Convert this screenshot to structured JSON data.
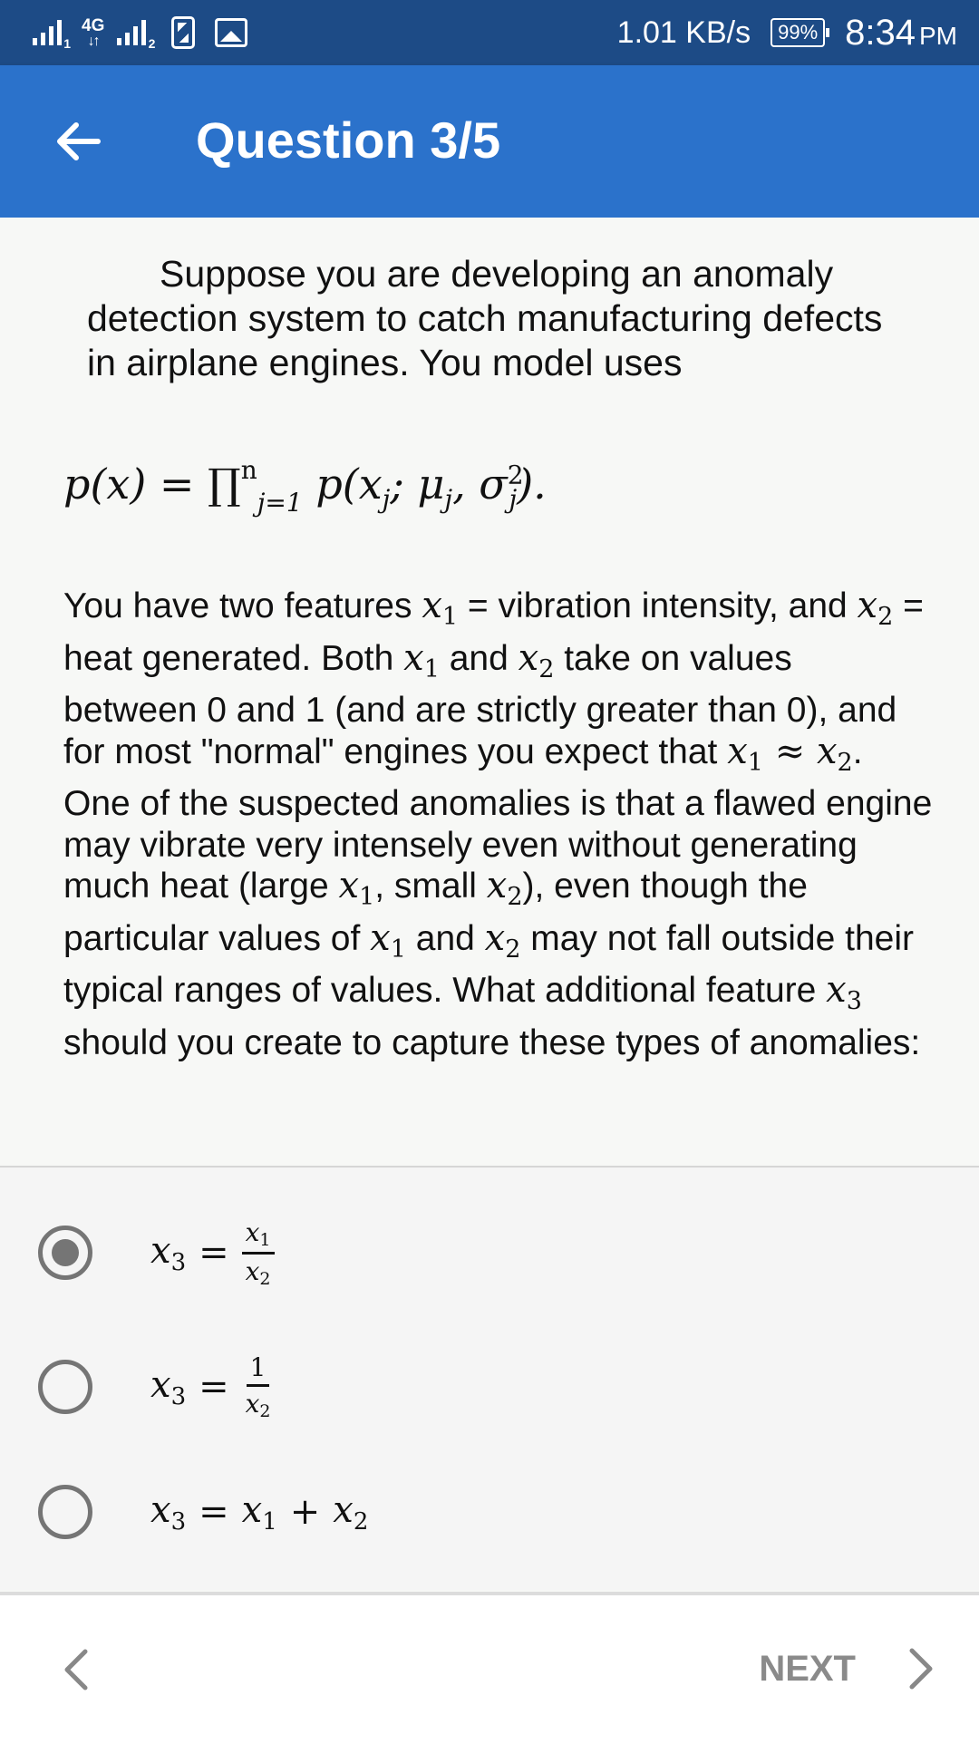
{
  "status_bar": {
    "network_type": "4G",
    "sim1_label": "1",
    "sim2_label": "2",
    "speed": "1.01 KB/s",
    "battery": "99%",
    "time": "8:34",
    "ampm": "PM",
    "icons": [
      "signal-icon",
      "data-arrows-icon",
      "signal-icon",
      "nfc-icon",
      "image-icon",
      "battery-icon"
    ]
  },
  "header": {
    "title": "Question 3/5",
    "back_icon": "arrow-left-icon"
  },
  "question": {
    "intro": "Suppose you are developing an anomaly detection system to catch manufacturing defects in airplane engines.  You model uses",
    "formula": {
      "lhs": "p(x) = ∏",
      "upper": "n",
      "lower": "j=1",
      "rhs": " p(x",
      "rhs_sub": "j",
      "rhs_mid": "; μ",
      "rhs_sub2": "j",
      "rhs_mid2": ", σ",
      "rhs_sup": "2",
      "rhs_sub3": "j",
      "rhs_end": ")."
    },
    "body": {
      "p1": "You have two features ",
      "p2": " = vibration intensity, and ",
      "p3": " = heat generated. Both ",
      "p4": " and ",
      "p5": " take on values between 0 and 1 (and are strictly greater than 0), and for most \"normal\" engines you expect that ",
      "approx": " ≈ ",
      "p6": ". One of the suspected anomalies is that a flawed engine may vibrate very intensely even without generating much heat (large ",
      "p7": ", small ",
      "p8": "), even though the particular values of ",
      "p9": " and ",
      "p10": " may not fall outside their typical ranges of values. What additional feature ",
      "p11": " should you create to capture these types of anomalies:",
      "var_x": "x",
      "sub1": "1",
      "sub2": "2",
      "sub3": "3"
    }
  },
  "options": [
    {
      "lhs": "x",
      "lhs_sub": "3",
      "eq": "=",
      "num": "x",
      "num_sub": "1",
      "den": "x",
      "den_sub": "2",
      "selected": true
    },
    {
      "lhs": "x",
      "lhs_sub": "3",
      "eq": "=",
      "num": "1",
      "den": "x",
      "den_sub": "2",
      "selected": false
    },
    {
      "lhs": "x",
      "lhs_sub": "3",
      "eq": "=",
      "a": "x",
      "a_sub": "1",
      "plus": "+",
      "b": "x",
      "b_sub": "2",
      "selected": false
    }
  ],
  "nav": {
    "next_label": "NEXT",
    "prev_icon": "chevron-left-icon",
    "next_icon": "chevron-right-icon"
  }
}
